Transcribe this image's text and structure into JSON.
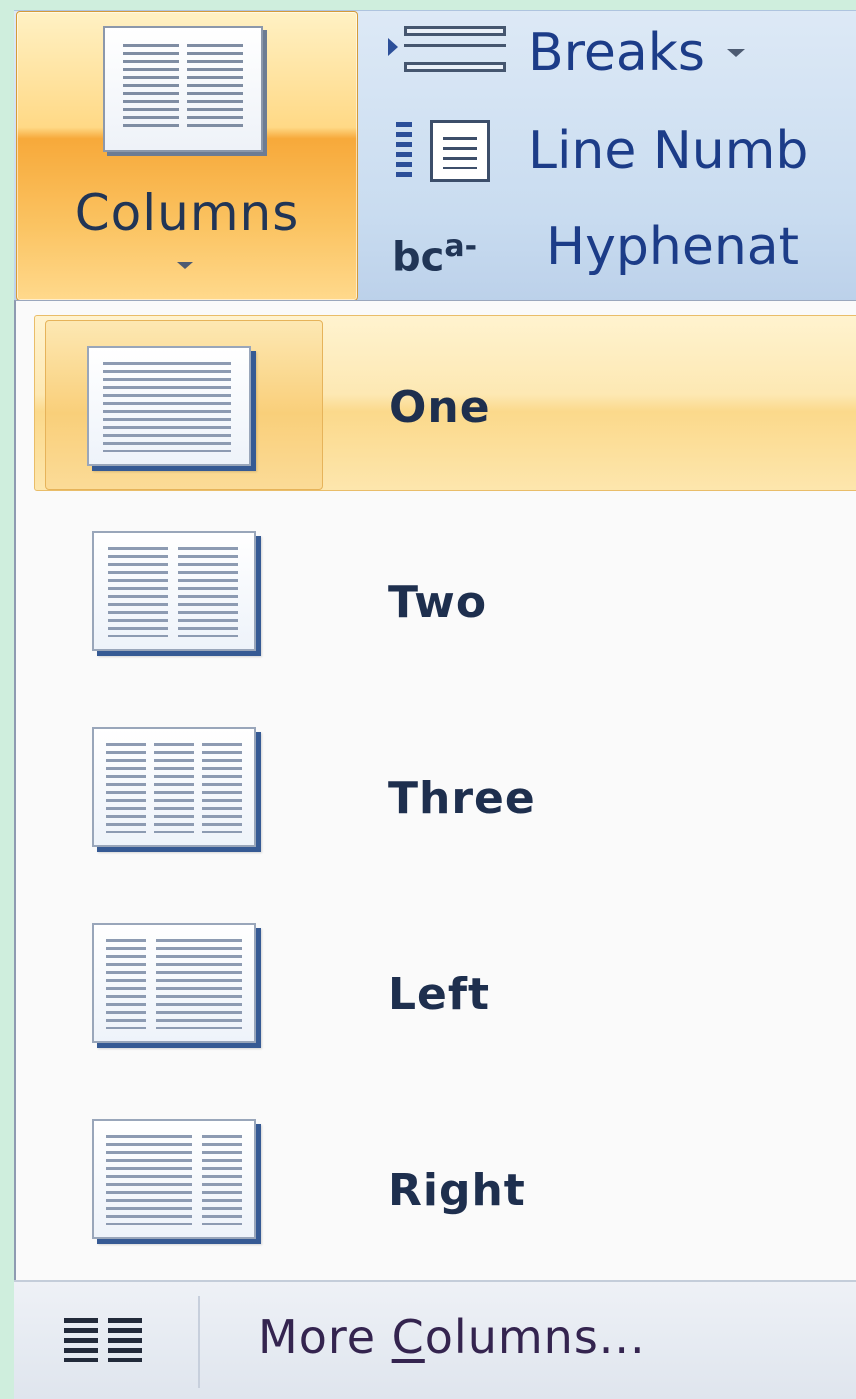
{
  "ribbon": {
    "columns_label": "Columns",
    "commands": [
      {
        "label": "Breaks",
        "icon": "breaks-icon",
        "has_dropdown": true
      },
      {
        "label": "Line Numb",
        "icon": "line-numbers-icon"
      },
      {
        "label": "Hyphenat",
        "icon": "hyphenation-icon"
      }
    ],
    "hyphenation_icon_text": "b",
    "hyphenation_icon_sup": "a-",
    "hyphenation_icon_c": "c"
  },
  "menu": {
    "items": [
      {
        "label": "One",
        "icon": "one-column-icon",
        "highlighted": true
      },
      {
        "label": "Two",
        "icon": "two-columns-icon"
      },
      {
        "label": "Three",
        "icon": "three-columns-icon"
      },
      {
        "label": "Left",
        "icon": "left-column-icon"
      },
      {
        "label": "Right",
        "icon": "right-column-icon"
      }
    ],
    "more": {
      "label_prefix": "More ",
      "label_accel": "C",
      "label_suffix": "olumns...",
      "icon": "columns-icon"
    }
  },
  "colors": {
    "highlight": "#fbd98b",
    "text": "#1e2f4e",
    "ribbon_text": "#1c3c88"
  }
}
